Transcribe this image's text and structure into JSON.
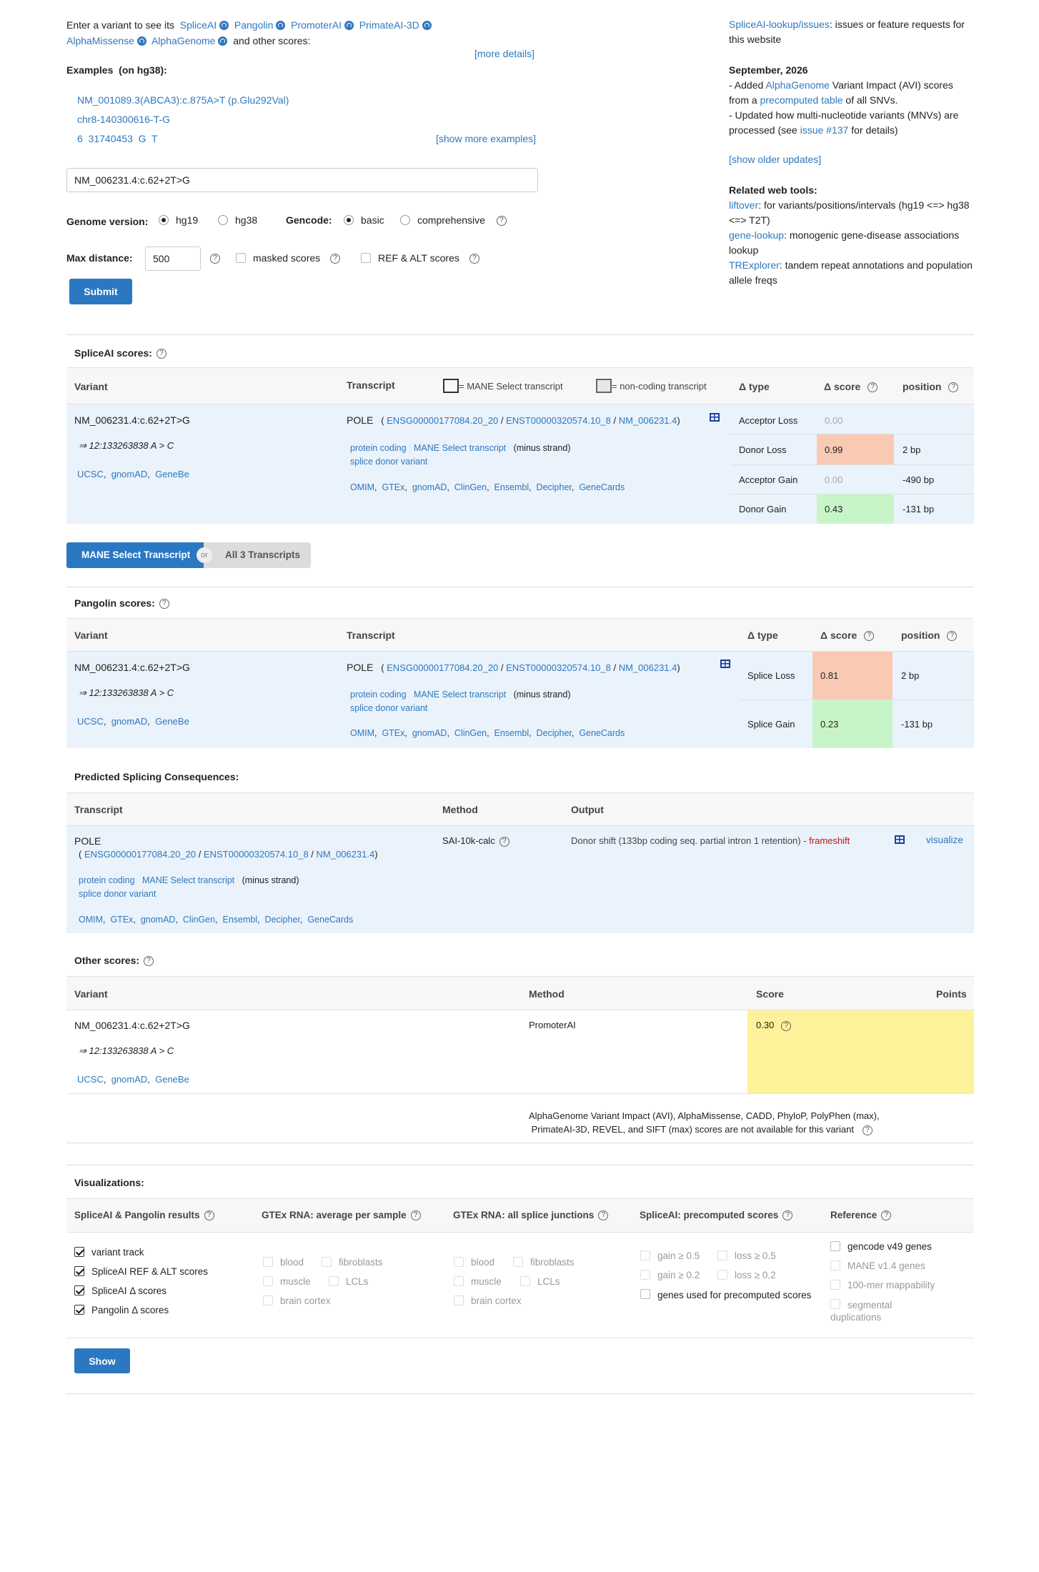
{
  "intro": {
    "prefix": "Enter a variant to see its",
    "tools": [
      "SpliceAI",
      "Pangolin",
      "PromoterAI",
      "PrimateAI-3D",
      "AlphaMissense",
      "AlphaGenome"
    ],
    "suffix": "and other scores:",
    "more_details": "[more details]",
    "examples_label": "Examples",
    "examples_build": "(on hg38):",
    "examples": [
      "NM_001089.3(ABCA3):c.875A>T (p.Glu292Val)",
      "chr8-140300616-T-G",
      "6  31740453  G  T"
    ],
    "show_more": "[show more examples]"
  },
  "form": {
    "input_value": "NM_006231.4:c.62+2T>G",
    "genome_label": "Genome version:",
    "genome_options": [
      "hg19",
      "hg38"
    ],
    "genome_selected": "hg19",
    "gencode_label": "Gencode:",
    "gencode_options": [
      "basic",
      "comprehensive"
    ],
    "max_distance_label": "Max distance:",
    "max_distance_value": "500",
    "masked_label": "masked scores",
    "refalt_label": "REF & ALT scores",
    "submit": "Submit"
  },
  "sidebar": {
    "issues_link": "SpliceAI-lookup/issues",
    "issues_text": ": issues or feature requests for this website",
    "date": "September, 2026",
    "update1_pre": "- Added ",
    "update1_link1": "AlphaGenome",
    "update1_mid": " Variant Impact (AVI) scores from a ",
    "update1_link2": "precomputed table",
    "update1_post": " of all SNVs.",
    "update2_pre": "- Updated how multi-nucleotide variants (MNVs) are processed (see ",
    "update2_link": "issue #137",
    "update2_post": " for details)",
    "show_older": "[show older updates]",
    "related_title": "Related web tools:",
    "tools": [
      {
        "name": "liftover",
        "desc": ": for variants/positions/intervals (hg19 <=> hg38 <=> T2T)"
      },
      {
        "name": "gene-lookup",
        "desc": ": monogenic gene-disease associations lookup"
      },
      {
        "name": "TRExplorer",
        "desc": ": tandem repeat annotations and population allele freqs"
      }
    ]
  },
  "variant": {
    "name": "NM_006231.4:c.62+2T>G",
    "norm": "⇒ 12:133263838 A > C",
    "links": [
      "UCSC",
      "gnomAD",
      "GeneBe"
    ]
  },
  "transcript": {
    "gene": "POLE",
    "ens_gene": "ENSG00000177084.20_20",
    "ens_tx": "ENST00000320574.10_8",
    "refseq": "NM_006231.4",
    "biotype": "protein coding",
    "mane": "MANE Select transcript",
    "strand": "(minus strand)",
    "consequence": "splice donor variant",
    "db_links": [
      "OMIM",
      "GTEx",
      "gnomAD",
      "ClinGen",
      "Ensembl",
      "Decipher",
      "GeneCards"
    ]
  },
  "spliceai": {
    "title": "SpliceAI scores:",
    "headers": {
      "variant": "Variant",
      "transcript": "Transcript",
      "legend_mane": "= MANE Select transcript",
      "legend_noncoding": "= non-coding transcript",
      "dtype": "Δ type",
      "dscore": "Δ score",
      "position": "position"
    },
    "rows": [
      {
        "type": "Acceptor Loss",
        "score": "0.00",
        "pos": ""
      },
      {
        "type": "Donor Loss",
        "score": "0.99",
        "pos": "2 bp"
      },
      {
        "type": "Acceptor Gain",
        "score": "0.00",
        "pos": "-490 bp"
      },
      {
        "type": "Donor Gain",
        "score": "0.43",
        "pos": "-131 bp"
      }
    ]
  },
  "toggle": {
    "mane": "MANE Select Transcript",
    "or": "or",
    "all": "All 3 Transcripts"
  },
  "pangolin": {
    "title": "Pangolin scores:",
    "headers": {
      "variant": "Variant",
      "transcript": "Transcript",
      "dtype": "Δ type",
      "dscore": "Δ score",
      "position": "position"
    },
    "rows": [
      {
        "type": "Splice Loss",
        "score": "0.81",
        "pos": "2 bp"
      },
      {
        "type": "Splice Gain",
        "score": "0.23",
        "pos": "-131 bp"
      }
    ]
  },
  "consequences": {
    "title": "Predicted Splicing Consequences:",
    "headers": {
      "transcript": "Transcript",
      "method": "Method",
      "output": "Output"
    },
    "method": "SAI-10k-calc",
    "output": "Donor shift (133bp coding seq. partial intron 1 retention) -",
    "frameshift": "frameshift",
    "visualize": "visualize"
  },
  "other": {
    "title": "Other scores:",
    "headers": {
      "variant": "Variant",
      "method": "Method",
      "score": "Score",
      "points": "Points"
    },
    "method": "PromoterAI",
    "score": "0.30",
    "note_line1": "AlphaGenome Variant Impact (AVI),  AlphaMissense,  CADD,  PhyloP,  PolyPhen (max),",
    "note_line2": "PrimateAI-3D,  REVEL,  and SIFT (max) scores are not available for this variant"
  },
  "viz": {
    "title": "Visualizations:",
    "col1": {
      "title": "SpliceAI & Pangolin results",
      "items": [
        "variant track",
        "SpliceAI REF & ALT scores",
        "SpliceAI Δ  scores",
        "Pangolin Δ  scores"
      ]
    },
    "col2": {
      "title": "GTEx RNA: average per sample",
      "items": [
        "blood",
        "fibroblasts",
        "muscle",
        "LCLs",
        "brain cortex"
      ]
    },
    "col3": {
      "title": "GTEx RNA: all splice junctions",
      "items": [
        "blood",
        "fibroblasts",
        "muscle",
        "LCLs",
        "brain cortex"
      ]
    },
    "col4": {
      "title": "SpliceAI: precomputed scores",
      "items": [
        "gain ≥ 0.5",
        "loss ≥ 0.5",
        "gain ≥ 0.2",
        "loss ≥ 0.2",
        "genes used for precomputed scores"
      ]
    },
    "col5": {
      "title": "Reference",
      "items": [
        "gencode v49 genes",
        "MANE v1.4 genes",
        "100-mer mappability",
        "segmental duplications"
      ]
    },
    "show": "Show"
  },
  "colors": {
    "link": "#2f78bd",
    "accent": "#2b78c2",
    "row_bg": "#eaf2fb",
    "high": "#f9c9b4",
    "low": "#c8f5c8",
    "yellow": "#fdf29a"
  }
}
